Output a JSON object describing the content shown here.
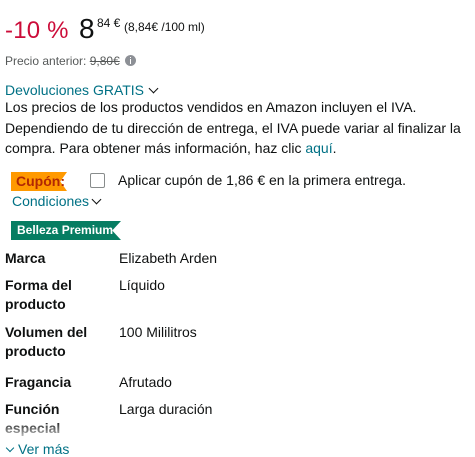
{
  "price": {
    "discount": "-10 %",
    "integer": "8",
    "decimal": "84 €",
    "unit_price": "(8,84€ /100 ml)"
  },
  "previous_price": {
    "label": "Precio anterior:",
    "value": "9,80€"
  },
  "returns": {
    "link_label": "Devoluciones GRATIS"
  },
  "iva_notice": {
    "text": "Los precios de los productos vendidos en Amazon incluyen el IVA. Dependiendo de tu dirección de entrega, el IVA puede variar al finalizar la compra. Para obtener más información, haz clic ",
    "link": "aquí",
    "end": "."
  },
  "coupon": {
    "badge": "Cupón:",
    "label": "Aplicar cupón de 1,86 € en la primera entrega.",
    "conditions": "Condiciones"
  },
  "premium_badge": "Belleza Premium",
  "specs": [
    {
      "key": "Marca",
      "value": "Elizabeth Arden"
    },
    {
      "key": "Forma del producto",
      "value": "Líquido"
    },
    {
      "key": "Volumen del producto",
      "value": "100 Mililitros"
    },
    {
      "key": "Fragancia",
      "value": "Afrutado"
    },
    {
      "key": "Función especial",
      "value": "Larga duración"
    }
  ],
  "see_more": "Ver más",
  "colors": {
    "discount": "#cc0c39",
    "link": "#007185",
    "coupon_badge": "#ff9900",
    "premium_badge": "#067d62"
  },
  "icons": [
    "info-icon",
    "chevron-down-icon",
    "checkbox"
  ]
}
